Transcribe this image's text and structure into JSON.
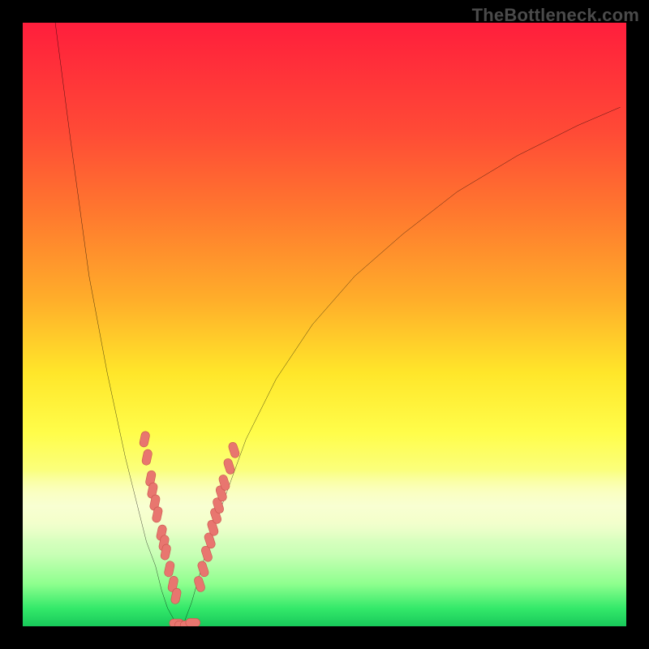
{
  "watermark": "TheBottleneck.com",
  "colors": {
    "frame": "#000000",
    "curve_stroke": "#000000",
    "marker_fill": "#e8766f",
    "marker_stroke": "#c9544d",
    "gradient_top": "#ff1e3c",
    "gradient_bottom": "#18c95a"
  },
  "chart_data": {
    "type": "line",
    "title": "",
    "xlabel": "",
    "ylabel": "",
    "xlim": [
      0,
      100
    ],
    "ylim": [
      0,
      100
    ],
    "grid": false,
    "curve_left": {
      "x": [
        5,
        8,
        11,
        14,
        17,
        19,
        20.5,
        22,
        23,
        24,
        25,
        25.8,
        26.5
      ],
      "y": [
        103,
        80,
        58,
        42,
        28,
        20,
        14,
        10,
        6,
        3,
        1.2,
        0.4,
        0
      ]
    },
    "curve_right": {
      "x": [
        26.5,
        28,
        30,
        33,
        37,
        42,
        48,
        55,
        63,
        72,
        82,
        92,
        99
      ],
      "y": [
        0,
        4,
        11,
        20,
        31,
        41,
        50,
        58,
        65,
        72,
        78,
        83,
        86
      ]
    },
    "markers_left": [
      {
        "x": 20.2,
        "y": 31
      },
      {
        "x": 20.6,
        "y": 28
      },
      {
        "x": 21.2,
        "y": 24.5
      },
      {
        "x": 21.5,
        "y": 22.5
      },
      {
        "x": 21.9,
        "y": 20.5
      },
      {
        "x": 22.3,
        "y": 18.5
      },
      {
        "x": 23.0,
        "y": 15.5
      },
      {
        "x": 23.4,
        "y": 13.8
      },
      {
        "x": 23.7,
        "y": 12.3
      },
      {
        "x": 24.3,
        "y": 9.5
      },
      {
        "x": 24.9,
        "y": 7.0
      },
      {
        "x": 25.4,
        "y": 5.0
      }
    ],
    "markers_bottom": [
      {
        "x": 25.5,
        "y": 0.5
      },
      {
        "x": 26.4,
        "y": 0.2
      },
      {
        "x": 27.3,
        "y": 0.2
      },
      {
        "x": 28.2,
        "y": 0.6
      }
    ],
    "markers_right": [
      {
        "x": 29.3,
        "y": 7.0
      },
      {
        "x": 29.9,
        "y": 9.5
      },
      {
        "x": 30.5,
        "y": 12.0
      },
      {
        "x": 31.0,
        "y": 14.2
      },
      {
        "x": 31.5,
        "y": 16.3
      },
      {
        "x": 32.0,
        "y": 18.3
      },
      {
        "x": 32.4,
        "y": 20.0
      },
      {
        "x": 32.9,
        "y": 22.0
      },
      {
        "x": 33.4,
        "y": 23.8
      },
      {
        "x": 34.2,
        "y": 26.5
      },
      {
        "x": 35.0,
        "y": 29.2
      }
    ]
  }
}
